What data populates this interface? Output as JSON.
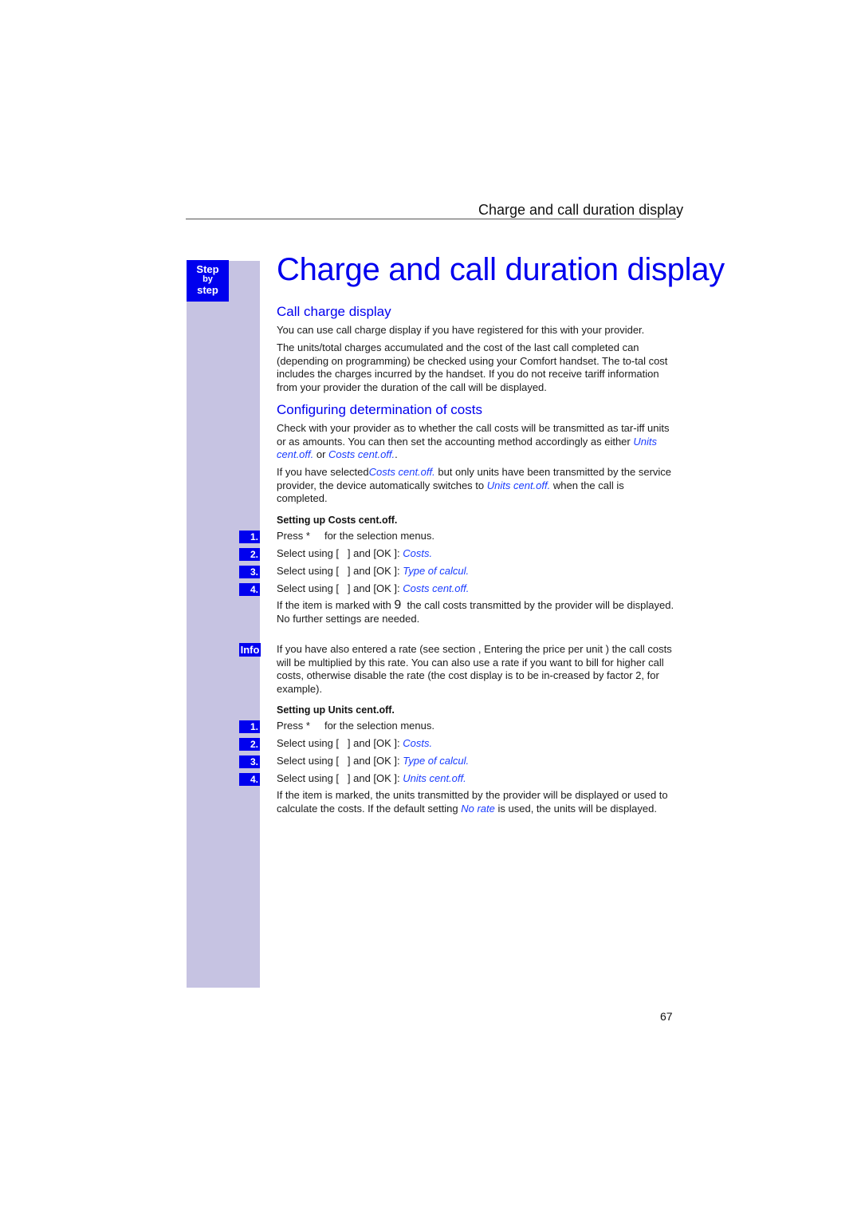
{
  "running_header": "Charge and call duration display",
  "sidebar": {
    "step_label": [
      "Step",
      "by",
      "step"
    ],
    "info_label": "Info"
  },
  "title": "Charge and call duration display",
  "section1": {
    "heading": "Call charge display",
    "p1": "You can use call charge display if you have registered for this with your provider.",
    "p2": "The units/total charges accumulated and the cost of the last call completed can (depending on programming) be checked using your Comfort handset. The to-tal cost includes the charges incurred by the handset. If you do not receive tariff information from your provider the duration of the call will be displayed."
  },
  "section2": {
    "heading": "Configuring determination of costs",
    "p1_a": "Check with your provider as to whether the call costs will be transmitted as tar-iff units or as amounts. You can then set the accounting method accordingly as either ",
    "p1_link1": "Units cent.off.",
    "p1_b": " or ",
    "p1_link2": "Costs cent.off.",
    "p1_c": ".",
    "p2_a": "If you have selected",
    "p2_link1": "Costs cent.off.",
    "p2_b": " but only units have been transmitted by the service provider, the device automatically switches to ",
    "p2_link2": "Units cent.off.",
    "p2_c": " when the call is completed."
  },
  "costs_setup": {
    "heading": "Setting up Costs cent.off.",
    "steps": [
      {
        "num": "1.",
        "text": "Press *     for the selection menus.",
        "value": ""
      },
      {
        "num": "2.",
        "text": "Select using [   ] and [OK ]: ",
        "value": "Costs."
      },
      {
        "num": "3.",
        "text": "Select using [   ] and [OK ]: ",
        "value": "Type of calcul."
      },
      {
        "num": "4.",
        "text": "Select using [   ] and [OK ]: ",
        "value": "Costs cent.off."
      }
    ],
    "note_a": "If the item is marked with ",
    "note_mark": "9",
    "note_b": "  the call costs transmitted by the provider will be displayed. No further settings are needed."
  },
  "info": {
    "text": "If you have also entered a rate (see section ,   Entering the price per unit  ) the call costs will be multiplied by this rate. You can also use a rate if you want to bill for higher call costs, otherwise disable the rate (the cost display is to be in-creased by factor 2, for example)."
  },
  "units_setup": {
    "heading": "Setting up Units cent.off.",
    "steps": [
      {
        "num": "1.",
        "text": "Press *     for the selection menus.",
        "value": ""
      },
      {
        "num": "2.",
        "text": "Select using [   ] and [OK ]: ",
        "value": "Costs."
      },
      {
        "num": "3.",
        "text": "Select using [   ] and [OK ]: ",
        "value": "Type of calcul."
      },
      {
        "num": "4.",
        "text": "Select using [   ] and [OK ]: ",
        "value": "Units cent.off."
      }
    ],
    "note_a": "If the item is marked, the units transmitted by the provider will be displayed or used to calculate the costs. If the default setting ",
    "note_link": "No rate",
    "note_b": " is used, the units will be displayed."
  },
  "page_number": "67"
}
